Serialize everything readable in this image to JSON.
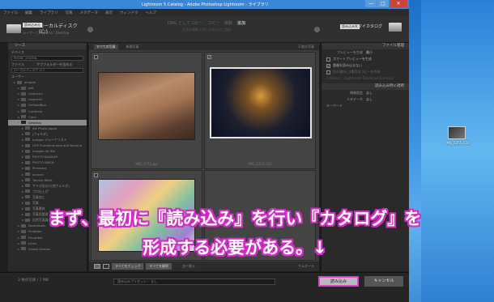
{
  "window": {
    "title": "Lightroom 5 Catalog - Adobe Photoshop Lightroom - ライブラリ",
    "minimize": "—",
    "maximize": "□",
    "close": "✕"
  },
  "menu": [
    "ファイル",
    "編集",
    "ライブラリ",
    "写真",
    "メタデータ",
    "表示",
    "ウィンドウ",
    "ヘルプ"
  ],
  "source": {
    "badge": "読み込み元",
    "title": "ローカルディスク (C:)",
    "path": "ユーザー \\ maporta \\ Desktop"
  },
  "modes": {
    "items": [
      "DNG としてコピー",
      "コピー",
      "移動",
      "追加"
    ],
    "active_index": 3,
    "subtitle": "写真を移動せずにカタログに追加"
  },
  "destination": {
    "badge": "読み込み先",
    "title": "マイカタログ"
  },
  "left_panel": {
    "header": "ソース",
    "devices_label": "デバイス",
    "device_field": "RYOBE_DIGITAL",
    "files_label": "ファイル",
    "subfolders_label": "サブフォルダーを含める",
    "local_disk": "ローカルディスク (C:)",
    "users_label": "ユーザー",
    "tree": [
      {
        "label": "akapoh",
        "level": 1
      },
      {
        "label": "pdf",
        "level": 2
      },
      {
        "label": "capture1",
        "level": 2
      },
      {
        "label": "capture2",
        "level": 2
      },
      {
        "label": "UnfixedBox",
        "level": 2
      },
      {
        "label": "Contacts",
        "level": 2
      },
      {
        "label": "Cont",
        "level": 2
      },
      {
        "label": "Desktop",
        "level": 2,
        "selected": true
      },
      {
        "label": "Art Photo Japan",
        "level": 3
      },
      {
        "label": "[フォルダ]",
        "level": 3
      },
      {
        "label": "Images ジャーナリスト",
        "level": 3
      },
      {
        "label": "LIFE Fundamentals and Beyond",
        "level": 3
      },
      {
        "label": "images for file",
        "level": 3
      },
      {
        "label": "PHOTO BAZAAR",
        "level": 3
      },
      {
        "label": "PHOTO WASA",
        "level": 3
      },
      {
        "label": "Pinterest",
        "level": 3
      },
      {
        "label": "xxxxxx",
        "level": 3
      },
      {
        "label": "Tamsin Work",
        "level": 3
      },
      {
        "label": "サイズ別分け(他フォルダ)",
        "level": 3
      },
      {
        "label": "プロ仕上げ",
        "level": 3
      },
      {
        "label": "写真加工",
        "level": 3
      },
      {
        "label": "写真",
        "level": 3
      },
      {
        "label": "写真素材",
        "level": 3
      },
      {
        "label": "写真用整理",
        "level": 3
      },
      {
        "label": "自然写真展示用素材",
        "level": 3
      },
      {
        "label": "Downloads",
        "level": 2
      },
      {
        "label": "Dropbox",
        "level": 2
      },
      {
        "label": "Favorites",
        "level": 2
      },
      {
        "label": "Links",
        "level": 2
      },
      {
        "label": "Saved Games",
        "level": 2
      }
    ]
  },
  "center": {
    "tabs": [
      "すべての写真",
      "新規写真"
    ],
    "count": "3 枚の写真",
    "files": [
      {
        "name": "IMG_0712.jpg",
        "checked": false
      },
      {
        "name": "IMG_0355.CR2",
        "checked": true
      },
      {
        "name": "",
        "checked": false
      },
      {
        "name": "",
        "checked": false
      }
    ],
    "check_all": "すべてをチェック",
    "uncheck_all": "すべてを解除",
    "sort_label": "並べ替え",
    "thumb_label": "サムネール"
  },
  "right_panel": {
    "file_handling": "ファイル管理",
    "preview_label": "プレビューを生成",
    "preview_value": "最小",
    "smart_preview": "スマートプレビューを生成",
    "no_duplicates": "重複を読み込まない",
    "second_copy": "別の場所に2番目のコピーを作成",
    "second_copy_path": "C:\\Users\\...\\Lightroom Download Backups",
    "apply_header": "読み込み時に適用",
    "dev_label": "現像設定",
    "dev_value": "なし",
    "meta_label": "メタデータ",
    "meta_value": "なし",
    "keywords_label": "キーワード"
  },
  "bottom": {
    "count_text": "3 枚の写真 / 7 MB",
    "preset_label": "読み込みプリセット：",
    "preset_value": "なし",
    "import": "読み込み",
    "cancel": "キャンセル"
  },
  "desktop_icon_label": "IMG_0355.CR2",
  "caption": {
    "line1": "まず、最初に『読み込み』を行い『カタログ』を",
    "line2": "形成する必要がある。↓"
  },
  "colors": {
    "accent_highlight": "#e040d0",
    "caption_outline": "#d42cc8",
    "titlebar": "#3b86d6"
  }
}
